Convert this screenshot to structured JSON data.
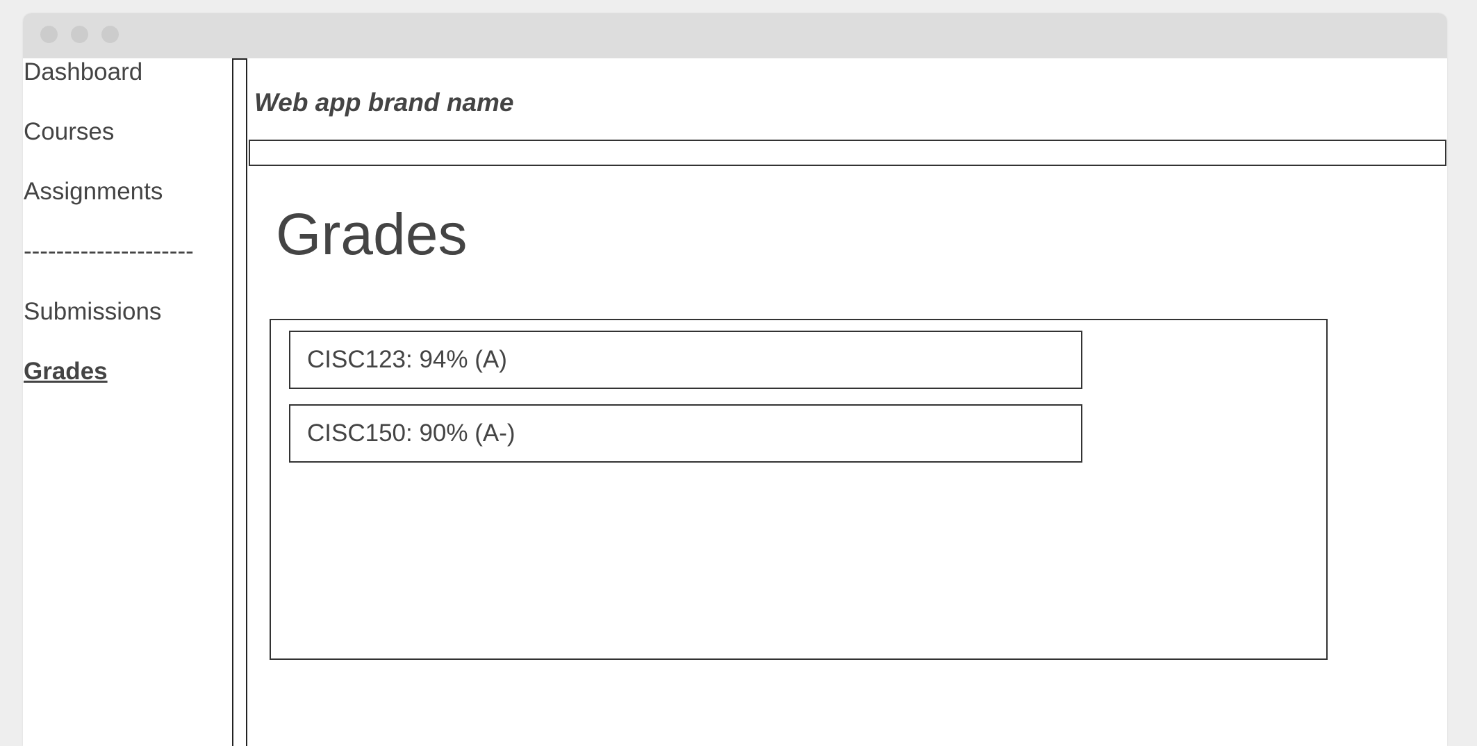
{
  "sidebar": {
    "items": [
      {
        "label": "Dashboard",
        "active": false
      },
      {
        "label": "Courses",
        "active": false
      },
      {
        "label": "Assignments",
        "active": false
      },
      {
        "label": "Submissions",
        "active": false
      },
      {
        "label": "Grades",
        "active": true
      }
    ],
    "divider": "---------------------"
  },
  "header": {
    "brand": "Web app brand name"
  },
  "main": {
    "title": "Grades",
    "grades": [
      {
        "text": "CISC123: 94% (A)"
      },
      {
        "text": "CISC150: 90% (A-)"
      }
    ]
  }
}
